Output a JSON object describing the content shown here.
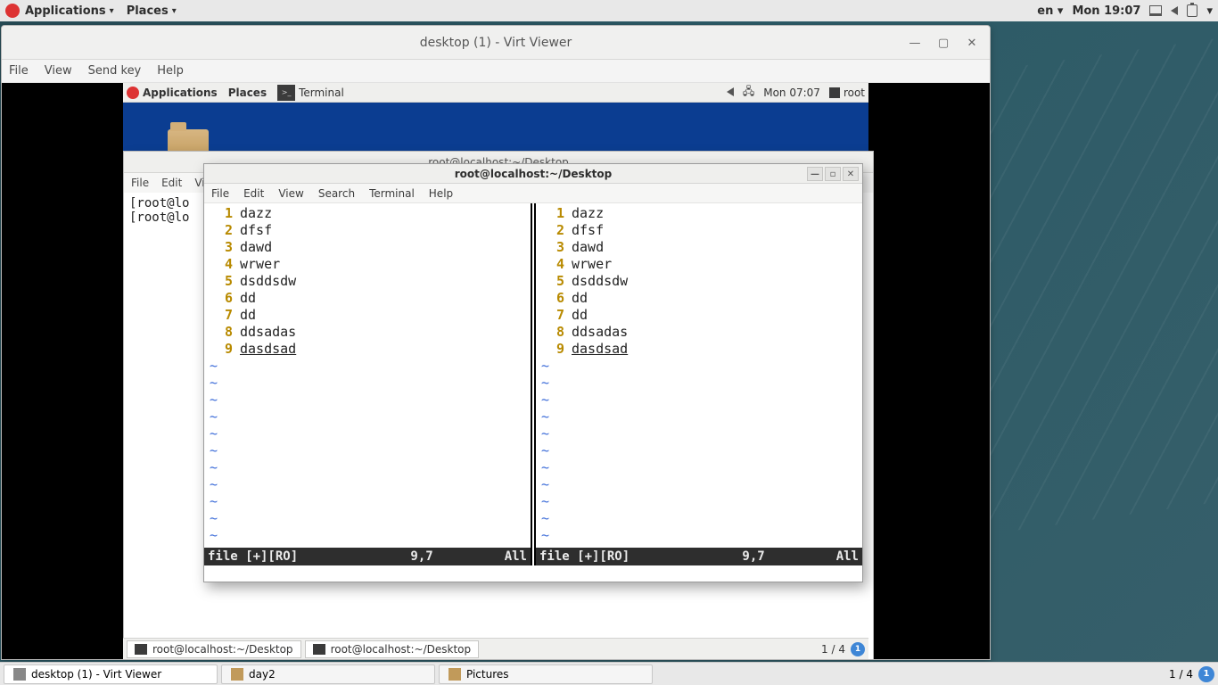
{
  "outer": {
    "applications": "Applications",
    "places": "Places",
    "lang": "en",
    "clock": "Mon 19:07"
  },
  "outer_taskbar": {
    "tasks": [
      {
        "label": "desktop (1) - Virt Viewer"
      },
      {
        "label": "day2"
      },
      {
        "label": "Pictures"
      }
    ],
    "ws": "1 / 4",
    "ws_btn": "1"
  },
  "virt": {
    "title": "desktop (1) - Virt Viewer",
    "menu": {
      "file": "File",
      "view": "View",
      "sendkey": "Send key",
      "help": "Help"
    }
  },
  "guest_topbar": {
    "applications": "Applications",
    "places": "Places",
    "appname": "Terminal",
    "clock": "Mon 07:07",
    "user": "root"
  },
  "back_window": {
    "title": "root@localhost:~/Desktop",
    "menu": {
      "file": "File",
      "edit": "Edit",
      "view": "Vie"
    },
    "body_line1": "[root@lo",
    "body_line2": "[root@lo"
  },
  "front_window": {
    "title": "root@localhost:~/Desktop",
    "menu": {
      "file": "File",
      "edit": "Edit",
      "view": "View",
      "search": "Search",
      "terminal": "Terminal",
      "help": "Help"
    },
    "vim": {
      "lines": [
        {
          "n": "1",
          "t": "dazz"
        },
        {
          "n": "2",
          "t": "dfsf"
        },
        {
          "n": "3",
          "t": "dawd"
        },
        {
          "n": "4",
          "t": "wrwer"
        },
        {
          "n": "5",
          "t": "dsddsdw"
        },
        {
          "n": "6",
          "t": "dd"
        },
        {
          "n": "7",
          "t": "dd"
        },
        {
          "n": "8",
          "t": "ddsadas"
        },
        {
          "n": "9",
          "t": "dasdsad"
        }
      ],
      "tilde": "~",
      "status_left_file": "file [+][RO]",
      "status_left_pos": "9,7",
      "status_left_all": "All",
      "status_right_file": "file [+][RO]",
      "status_right_pos": "9,7",
      "status_right_all": "All"
    }
  },
  "guest_taskbar": {
    "tasks": [
      {
        "label": "root@localhost:~/Desktop"
      },
      {
        "label": "root@localhost:~/Desktop"
      }
    ],
    "ws": "1 / 4",
    "ws_btn": "1"
  }
}
